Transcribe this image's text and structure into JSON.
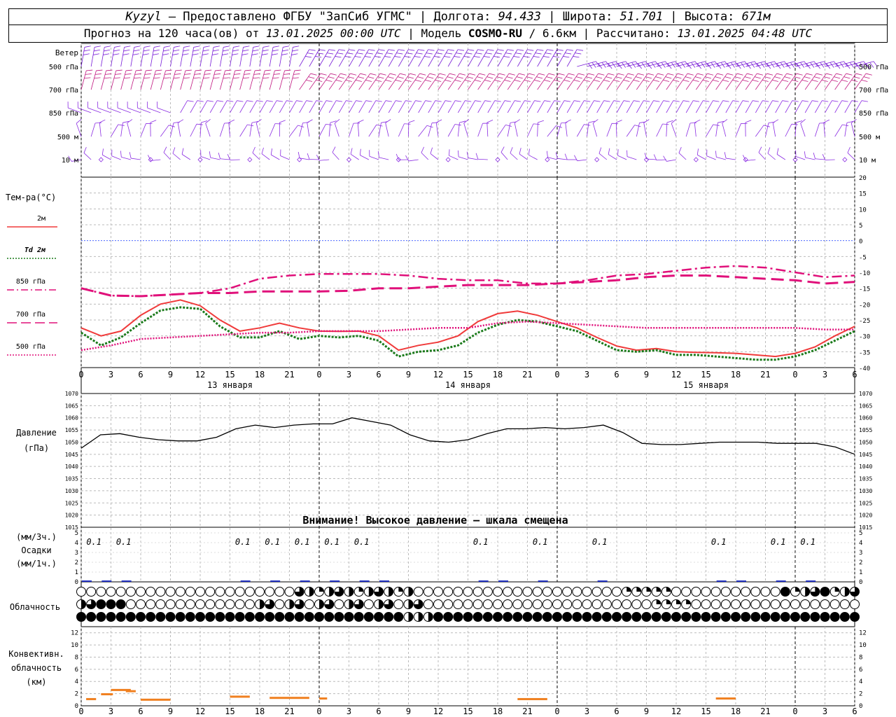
{
  "header": {
    "station": "Kyzyl",
    "provider": " – Предоставлено ФГБУ \"ЗапСиб УГМС\" | Долгота: ",
    "longitude": "94.433",
    "lat_label": " | Широта: ",
    "latitude": "51.701",
    "alt_label": " | Высота: ",
    "altitude": "671м",
    "forecast_label": "Прогноз на 120 часа(ов) от ",
    "forecast_start": "13.01.2025 00:00 UTC",
    "model_label": " | Модель ",
    "model": "COSMO-RU",
    "resolution": " / 6.6км",
    "calc_label": " | Рассчитано: ",
    "calculated": "13.01.2025 04:48 UTC"
  },
  "time_axis": {
    "hour_ticks": [
      "0",
      "3",
      "6",
      "9",
      "12",
      "15",
      "18",
      "21",
      "0",
      "3",
      "6",
      "9",
      "12",
      "15",
      "18",
      "21",
      "0",
      "3",
      "6",
      "9",
      "12",
      "15",
      "18",
      "21",
      "0",
      "3",
      "6"
    ],
    "date_labels": [
      "13 января",
      "14 января",
      "15 января"
    ]
  },
  "wind_panel": {
    "title": "Ветер",
    "levels": [
      "500 гПа",
      "700 гПа",
      "850 гПа",
      "500 м",
      "10 м"
    ],
    "colors": {
      "500hpa": "#7a1fd8",
      "700hpa": "#c0157f",
      "850hpa": "#8a2be2",
      "500m": "#8a2be2",
      "10m": "#8a2be2"
    }
  },
  "temp_panel": {
    "title": "Тем-ра(°C)",
    "legend": [
      {
        "label": "2м",
        "color": "#f03a3a",
        "style": "solid"
      },
      {
        "label": "Td  2м",
        "color": "#1a7a1a",
        "style": "dotted"
      },
      {
        "label": "850 гПа",
        "color": "#e0107a",
        "style": "dashdot"
      },
      {
        "label": "700 гПа",
        "color": "#e0107a",
        "style": "longdash"
      },
      {
        "label": "500 гПа",
        "color": "#e0107a",
        "style": "dotted"
      }
    ],
    "ticks": [
      "20",
      "15",
      "10",
      "5",
      "0",
      "-5",
      "-10",
      "-15",
      "-20",
      "-25",
      "-30",
      "-35",
      "-40"
    ]
  },
  "pressure_panel": {
    "title": "Давление",
    "unit": "(гПа)",
    "ticks": [
      "1070",
      "1065",
      "1060",
      "1055",
      "1050",
      "1045",
      "1040",
      "1035",
      "1030",
      "1025",
      "1020",
      "1015"
    ],
    "warning": "Внимание! Высокое давление – шкала смещена"
  },
  "precip_panel": {
    "title": "Осадки",
    "unit3h": "(мм/3ч.)",
    "unit1h": "(мм/1ч.)",
    "ticks": [
      "5",
      "4",
      "3",
      "2",
      "1",
      "0"
    ],
    "labels": [
      "0.1",
      "0.1",
      "0.1",
      "0.1",
      "0.1",
      "0.1",
      "0.1",
      "0.1",
      "0.1",
      "0.1",
      "0.1",
      "0.1",
      "0.1"
    ]
  },
  "cloud_panel": {
    "title": "Облачность"
  },
  "convective_panel": {
    "title": "Конвективн.",
    "title2": "облачность",
    "unit": "(км)",
    "ticks": [
      "12",
      "10",
      "8",
      "6",
      "4",
      "2",
      "0"
    ],
    "bar_color": "#f08020"
  },
  "chart_data": [
    {
      "type": "line",
      "title": "Тем-ра(°C)",
      "x_unit": "hours from 13.01.2025 00:00 UTC",
      "ylim": [
        -40,
        20
      ],
      "series": [
        {
          "name": "2м",
          "x": [
            0,
            2,
            4,
            6,
            8,
            10,
            12,
            14,
            16,
            18,
            20,
            22,
            24,
            26,
            28,
            30,
            32,
            34,
            36,
            38,
            40,
            42,
            44,
            46,
            48,
            50,
            52,
            54,
            56,
            58,
            60,
            62,
            64,
            66,
            68,
            70,
            72,
            74,
            76,
            78
          ],
          "values": [
            -27.5,
            -30,
            -28.5,
            -23.5,
            -20,
            -18.7,
            -20.5,
            -25,
            -28.5,
            -27.5,
            -26,
            -27.5,
            -28.5,
            -28.6,
            -28.5,
            -30,
            -34.5,
            -33,
            -32,
            -30,
            -25.5,
            -23,
            -22.2,
            -23.5,
            -25.5,
            -27.5,
            -30.5,
            -33.2,
            -34.5,
            -34,
            -35,
            -35.2,
            -35.3,
            -35.5,
            -36,
            -36.5,
            -35.5,
            -33.5,
            -30,
            -27
          ]
        },
        {
          "name": "Td  2м",
          "x": [
            0,
            2,
            4,
            6,
            8,
            10,
            12,
            14,
            16,
            18,
            20,
            22,
            24,
            26,
            28,
            30,
            32,
            34,
            36,
            38,
            40,
            42,
            44,
            46,
            48,
            50,
            52,
            54,
            56,
            58,
            60,
            62,
            64,
            66,
            68,
            70,
            72,
            74,
            76,
            78
          ],
          "values": [
            -29,
            -33,
            -30.5,
            -26,
            -22,
            -21,
            -21.5,
            -27,
            -30.5,
            -30.5,
            -28.5,
            -31,
            -30,
            -30.5,
            -30,
            -31.5,
            -36.5,
            -35,
            -34.5,
            -33,
            -29,
            -26.5,
            -25,
            -25.5,
            -27,
            -28.5,
            -31.5,
            -34.5,
            -35,
            -34.5,
            -36,
            -36,
            -36.5,
            -37,
            -37.5,
            -37.5,
            -36.5,
            -34.5,
            -31.5,
            -28.5
          ]
        },
        {
          "name": "850 гПа",
          "values": [
            -15,
            -17.3,
            -17.5,
            -17,
            -16.5,
            -15,
            -12,
            -11,
            -10.5,
            -10.5,
            -10.5,
            -11,
            -12,
            -12.5,
            -12.5,
            -13.5,
            -13.5,
            -12.5,
            -11,
            -10.5,
            -9.5,
            -8.5,
            -8,
            -8.5,
            -10,
            -11.5,
            -11
          ]
        },
        {
          "name": "700 гПа",
          "values": [
            -15,
            -17.3,
            -17.5,
            -17,
            -16.5,
            -16.5,
            -16,
            -16,
            -16,
            -15.8,
            -15,
            -15,
            -14.5,
            -14,
            -14,
            -14,
            -13.5,
            -13,
            -12.5,
            -11.5,
            -11,
            -11,
            -11.5,
            -12,
            -12.5,
            -13.5,
            -13
          ]
        },
        {
          "name": "500 гПа",
          "values": [
            -34.5,
            -33,
            -31,
            -30.5,
            -30,
            -29.5,
            -29,
            -29,
            -28.5,
            -28.5,
            -28.5,
            -28,
            -27.5,
            -27.5,
            -26,
            -25.5,
            -26,
            -26.5,
            -27,
            -27.5,
            -27.5,
            -27.5,
            -27.5,
            -27.5,
            -27.5,
            -28,
            -28
          ]
        }
      ]
    },
    {
      "type": "line",
      "title": "Давление",
      "ylabel": "(гПа)",
      "ylim": [
        1015,
        1070
      ],
      "series": [
        {
          "name": "Давление",
          "x": [
            0,
            1,
            2,
            3,
            4,
            5,
            6,
            7,
            8,
            9,
            10,
            11,
            12,
            13,
            14,
            15,
            16,
            17,
            18,
            19,
            20,
            21,
            22,
            23,
            24,
            25,
            26,
            27,
            28,
            29,
            30,
            31,
            32,
            33,
            34,
            35,
            36,
            37,
            38,
            39,
            40
          ],
          "values": [
            1047.5,
            1053,
            1053.5,
            1052,
            1051,
            1050.5,
            1050.5,
            1052,
            1055.5,
            1057,
            1056,
            1057,
            1057.5,
            1057.5,
            1060,
            1058.5,
            1057,
            1053,
            1050.5,
            1050,
            1051,
            1053.5,
            1055.5,
            1055.5,
            1056,
            1055.5,
            1056,
            1057,
            1054,
            1049.5,
            1049,
            1049,
            1049.5,
            1050,
            1050,
            1050,
            1049.5,
            1049.5,
            1049.5,
            1048,
            1045
          ]
        }
      ]
    },
    {
      "type": "bar",
      "title": "Конвективн. облачность",
      "ylabel": "(км)",
      "ylim": [
        0,
        13
      ],
      "series": [
        {
          "name": "base",
          "x": [
            0.5,
            2,
            3,
            4.5,
            6,
            15,
            19,
            24,
            44,
            64
          ],
          "values": [
            1.1,
            1.9,
            2.6,
            2.4,
            1,
            1.5,
            1.3,
            1.2,
            1.1,
            1.2
          ]
        }
      ]
    }
  ]
}
